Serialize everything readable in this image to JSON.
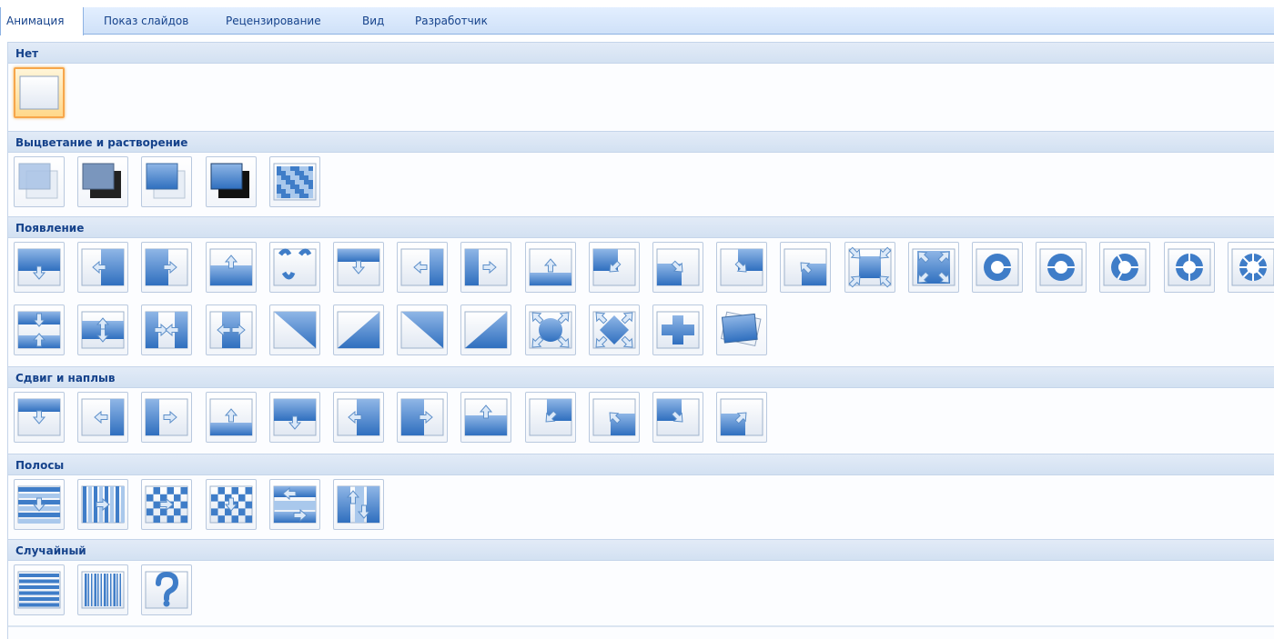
{
  "tabs": [
    {
      "label": "Анимация",
      "active": true
    },
    {
      "label": "Показ слайдов",
      "active": false
    },
    {
      "label": "Рецензирование",
      "active": false
    },
    {
      "label": "Вид",
      "active": false
    },
    {
      "label": "Разработчик",
      "active": false
    }
  ],
  "sections": [
    {
      "title": "Нет"
    },
    {
      "title": "Выцветание и растворение"
    },
    {
      "title": "Появление"
    },
    {
      "title": "Сдвиг и наплыв"
    },
    {
      "title": "Полосы"
    },
    {
      "title": "Случайный"
    }
  ],
  "colors": {
    "accent_blue": "#3f7dc8",
    "light_blue": "#a9c8ec",
    "selection_orange": "#f7a64b",
    "header_bg": "#d3e1f2"
  }
}
